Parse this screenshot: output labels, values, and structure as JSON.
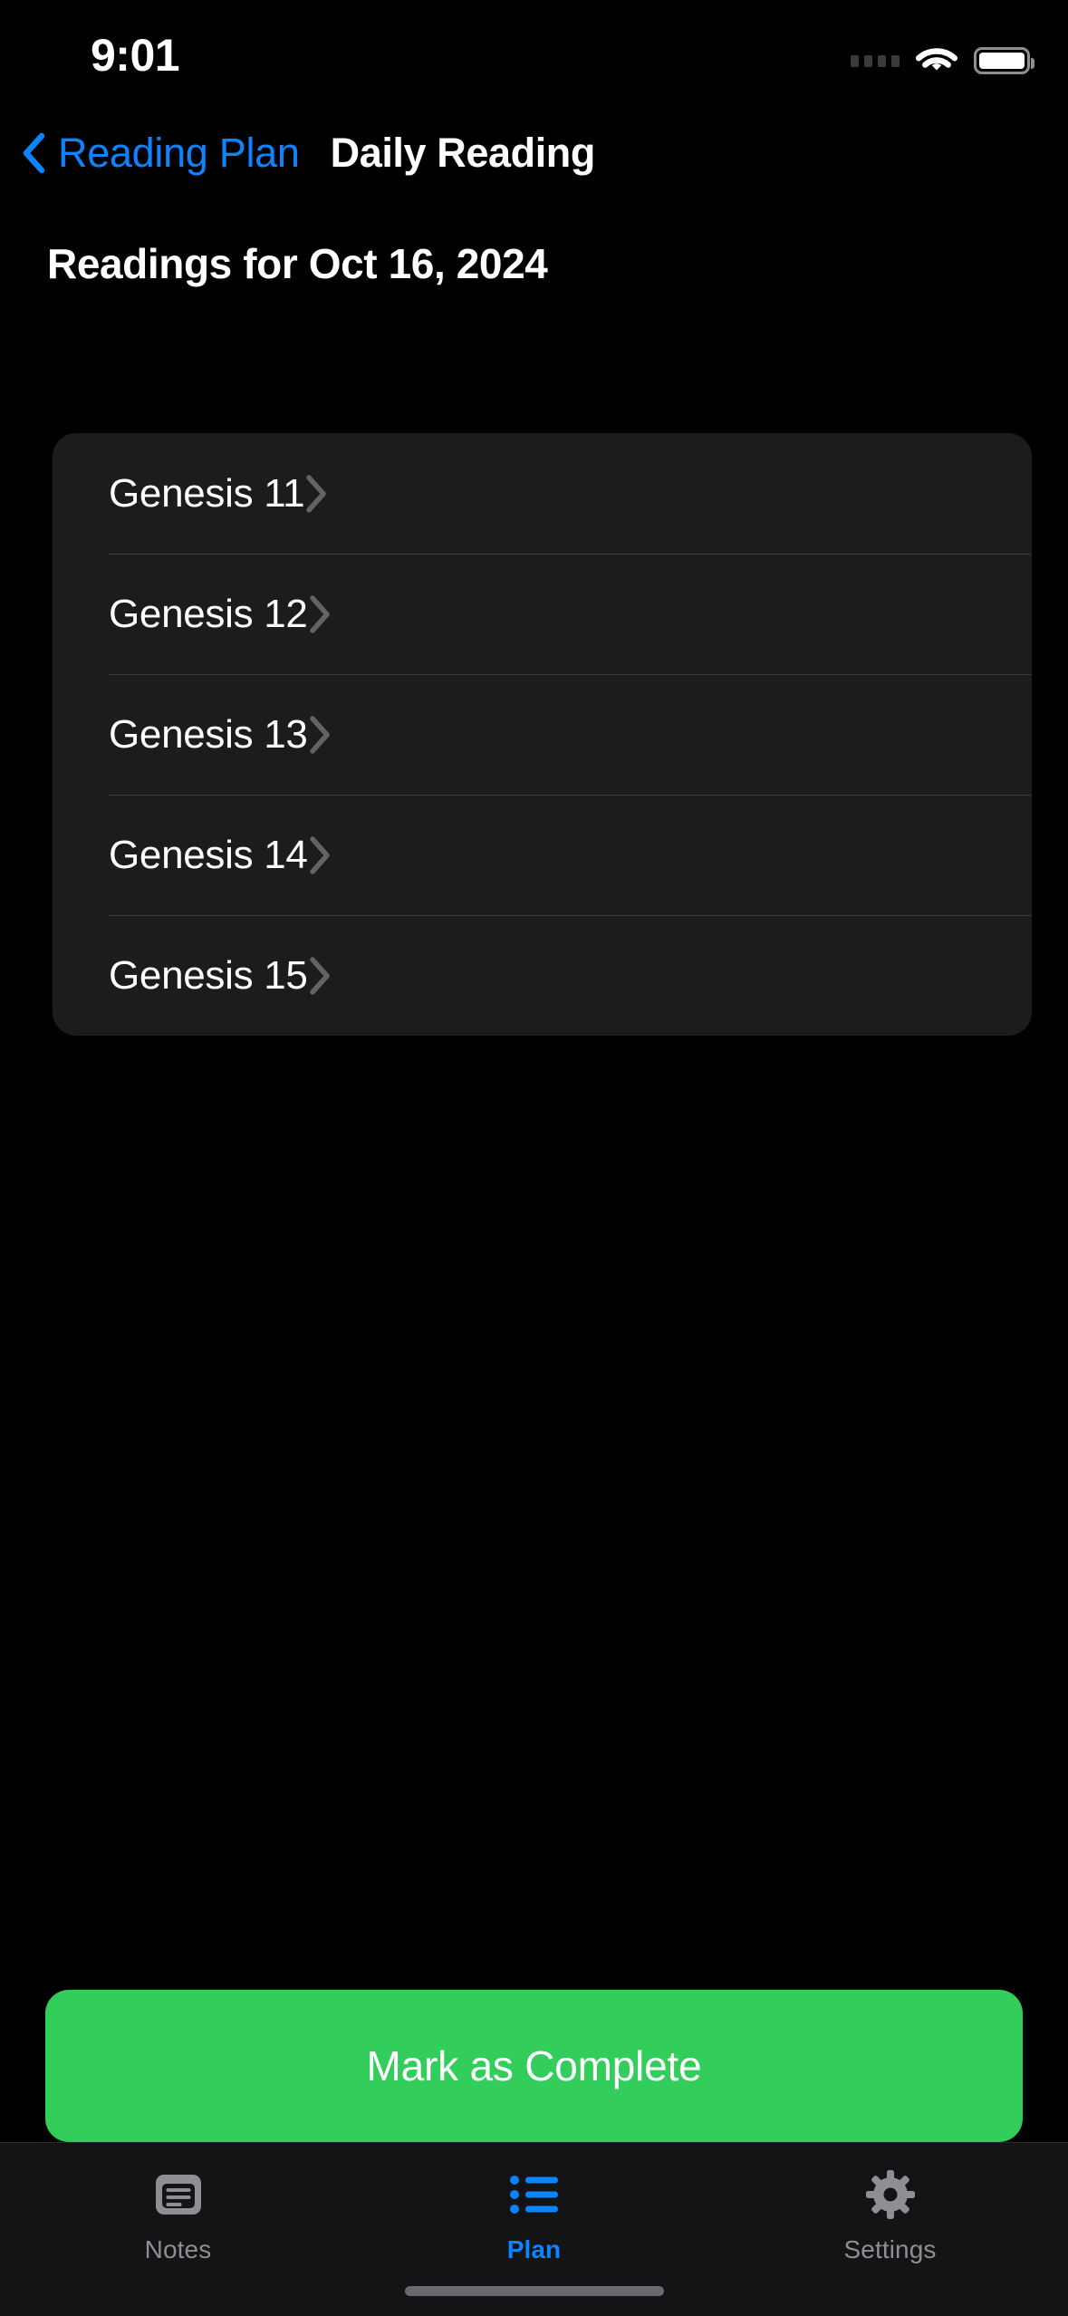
{
  "status_bar": {
    "time": "9:01",
    "cellular_icon": "cellular-dots-icon",
    "wifi_icon": "wifi-icon",
    "battery_icon": "battery-full-icon"
  },
  "nav_bar": {
    "back_icon": "chevron-left-icon",
    "back_label": "Reading Plan",
    "title": "Daily Reading"
  },
  "main": {
    "section_heading": "Readings for Oct 16, 2024",
    "readings": [
      {
        "label": "Genesis 11",
        "chevron": "chevron-right-icon"
      },
      {
        "label": "Genesis 12",
        "chevron": "chevron-right-icon"
      },
      {
        "label": "Genesis 13",
        "chevron": "chevron-right-icon"
      },
      {
        "label": "Genesis 14",
        "chevron": "chevron-right-icon"
      },
      {
        "label": "Genesis 15",
        "chevron": "chevron-right-icon"
      }
    ]
  },
  "cta": {
    "label": "Mark as Complete",
    "color": "#32CD5A"
  },
  "tab_bar": {
    "accent_color": "#0A84FF",
    "inactive_color": "#8E8E93",
    "tabs": [
      {
        "label": "Notes",
        "icon": "notes-icon",
        "active": false
      },
      {
        "label": "Plan",
        "icon": "list-bullet-icon",
        "active": true
      },
      {
        "label": "Settings",
        "icon": "gear-icon",
        "active": false
      }
    ]
  },
  "home_indicator": "home-indicator"
}
